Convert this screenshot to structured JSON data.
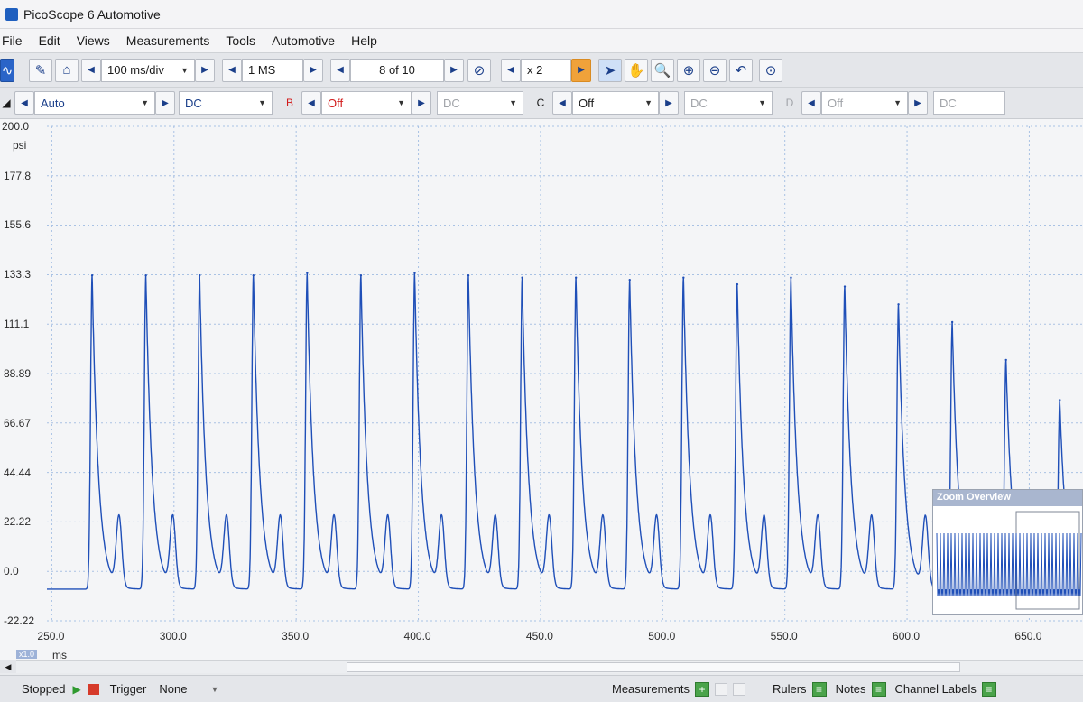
{
  "window": {
    "title": "PicoScope 6 Automotive"
  },
  "menu": [
    "File",
    "Edit",
    "Views",
    "Measurements",
    "Tools",
    "Automotive",
    "Help"
  ],
  "toolbar1": {
    "timebase": "100 ms/div",
    "samples": "1 MS",
    "buffer": "8 of 10",
    "zoom": "x 2"
  },
  "toolbar2": {
    "channel_a": {
      "range": "Auto",
      "coupling": "DC"
    },
    "channel_b": {
      "letter": "B",
      "range": "Off",
      "coupling": "DC"
    },
    "channel_c": {
      "letter": "C",
      "range": "Off",
      "coupling": "DC"
    },
    "channel_d": {
      "letter": "D",
      "range": "Off",
      "coupling": "DC"
    }
  },
  "chart_data": {
    "type": "line",
    "ylabel": "psi",
    "xlabel": "ms",
    "y_ticks": [
      "200.0",
      "177.8",
      "155.6",
      "133.3",
      "111.1",
      "88.89",
      "66.67",
      "44.44",
      "22.22",
      "0.0",
      "-22.22"
    ],
    "x_ticks": [
      "250.0",
      "300.0",
      "350.0",
      "400.0",
      "450.0",
      "500.0",
      "550.0",
      "600.0",
      "650.0"
    ],
    "ylim": [
      -22.22,
      200.0
    ],
    "xlim": [
      248,
      672
    ],
    "grid": true,
    "series_color": "#1f4fb8",
    "peaks": [
      {
        "x": 266.5,
        "y": 133
      },
      {
        "x": 288.5,
        "y": 133
      },
      {
        "x": 310.5,
        "y": 133
      },
      {
        "x": 332.5,
        "y": 133
      },
      {
        "x": 354.5,
        "y": 134
      },
      {
        "x": 376.5,
        "y": 133
      },
      {
        "x": 398.5,
        "y": 134
      },
      {
        "x": 420.5,
        "y": 133
      },
      {
        "x": 442.5,
        "y": 132
      },
      {
        "x": 464.5,
        "y": 132
      },
      {
        "x": 486.5,
        "y": 131
      },
      {
        "x": 508.5,
        "y": 132
      },
      {
        "x": 530.5,
        "y": 129
      },
      {
        "x": 552.5,
        "y": 132
      },
      {
        "x": 574.5,
        "y": 128
      },
      {
        "x": 596.5,
        "y": 120
      },
      {
        "x": 618.5,
        "y": 112
      },
      {
        "x": 640.5,
        "y": 95
      },
      {
        "x": 662.5,
        "y": 77
      }
    ],
    "secondary_bump": 25,
    "trough": -8
  },
  "x_multiplier": "x1.0",
  "zoom_overview": {
    "title": "Zoom Overview"
  },
  "status": {
    "state": "Stopped",
    "trigger_label": "Trigger",
    "trigger_mode": "None",
    "measurements": "Measurements",
    "rulers": "Rulers",
    "notes": "Notes",
    "channel_labels": "Channel Labels"
  }
}
